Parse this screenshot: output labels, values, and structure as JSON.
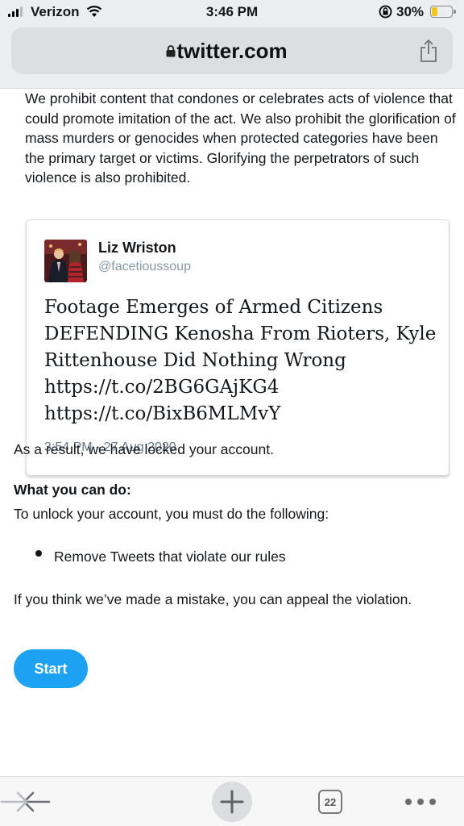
{
  "status_bar": {
    "carrier": "Verizon",
    "time": "3:46 PM",
    "battery": "30%",
    "battery_level": 0.3,
    "signal_bars": 3
  },
  "browser": {
    "url": "twitter.com",
    "tab_count": "22"
  },
  "policy_text": "We prohibit content that condones or celebrates acts of violence that could promote imitation of the act. We also prohibit the glorification of mass murders or genocides when protected categories have been the primary target or victims. Glorifying the perpetrators of such violence is also prohibited.",
  "tweet": {
    "name": "Liz Wriston",
    "handle": "@facetioussoup",
    "text": "Footage Emerges of Armed Citizens DEFENDING Kenosha From Rioters, Kyle Rittenhouse Did Nothing Wrong https://t.co/2BG6GAjKG4 https://t.co/BixB6MLMvY",
    "timestamp": "3:54 PM - 27 Aug 2020"
  },
  "result_text": "As a result, we have locked your account.",
  "what_you_can_do": {
    "heading": "What you can do:",
    "instruction": "To unlock your account, you must do the following:",
    "steps": [
      "Remove Tweets that violate our rules"
    ]
  },
  "appeal_text": "If you think we’ve made a mistake, you can appeal the violation.",
  "start_button": "Start",
  "colors": {
    "accent": "#1da1f2",
    "text": "#14171a",
    "muted": "#657786",
    "battery": "#f5c518"
  },
  "icons": {
    "back": "back-arrow-icon",
    "forward": "forward-arrow-icon",
    "new_tab": "plus-icon",
    "tabs": "tab-count-icon",
    "more": "more-dots-icon",
    "share": "share-icon",
    "secure": "lock-icon"
  }
}
